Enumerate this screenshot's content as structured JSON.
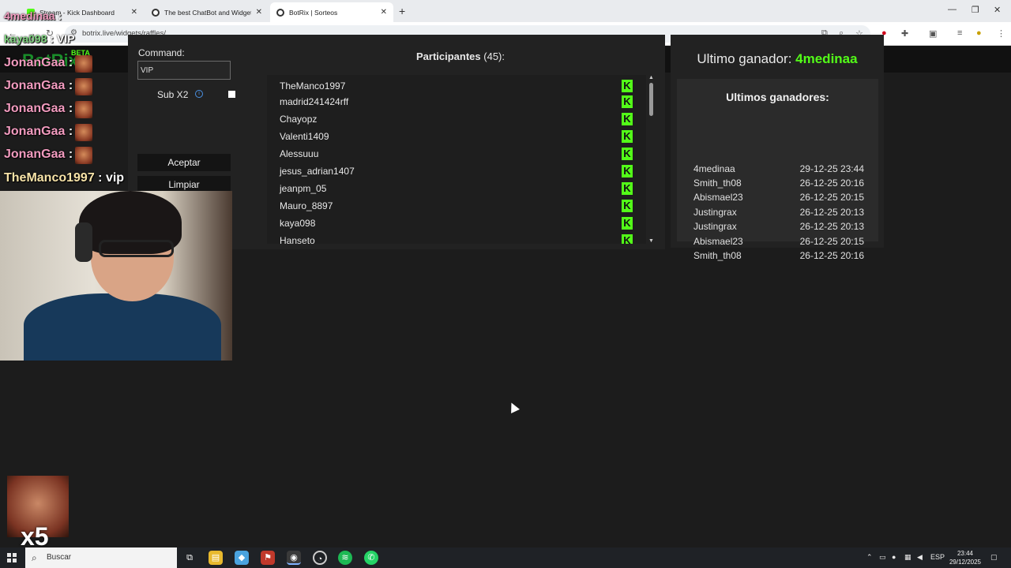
{
  "browser": {
    "tabs": [
      {
        "title": "Stream - Kick Dashboard",
        "favicon_color": "#53fc18"
      },
      {
        "title": "The best ChatBot and Widgets",
        "favicon_color": "#333333"
      },
      {
        "title": "BotRix | Sorteos",
        "favicon_color": "#333333"
      }
    ],
    "url": "botrix.live/widgets/raffles/"
  },
  "site": {
    "logo": "BotRix",
    "beta": "BETA"
  },
  "command": {
    "label": "Command:",
    "value": "VIP",
    "sub_label": "Sub X2",
    "info": "i",
    "accept": "Aceptar",
    "clear": "Limpiar"
  },
  "participants": {
    "title": "Participantes",
    "count": "(45):",
    "badge": "K",
    "items": [
      "TheManco1997",
      "madrid241424rff",
      "Chayopz",
      "Valenti1409",
      "Alessuuu",
      "jesus_adrian1407",
      "jeanpm_05",
      "Mauro_8897",
      "kaya098",
      "Hanseto"
    ]
  },
  "winners": {
    "last_label": "Ultimo ganador:",
    "last_name": "4medinaa",
    "list_title": "Ultimos ganadores:",
    "items": [
      {
        "name": "4medinaa",
        "date": "29-12-25 23:44"
      },
      {
        "name": "Smith_th08",
        "date": "26-12-25 20:16"
      },
      {
        "name": "Abismael23",
        "date": "26-12-25 20:15"
      },
      {
        "name": "Justingrax",
        "date": "26-12-25 20:13"
      },
      {
        "name": "Justingrax",
        "date": "26-12-25 20:13"
      },
      {
        "name": "Abismael23",
        "date": "26-12-25 20:15"
      },
      {
        "name": "Smith_th08",
        "date": "26-12-25 20:16"
      }
    ]
  },
  "overlay": {
    "chat": [
      {
        "user": "4medinaa",
        "sep": ":"
      },
      {
        "user": "kaya098",
        "sep": ":",
        "msg": "VIP"
      },
      {
        "user": "JonanGaa",
        "sep": ":"
      },
      {
        "user": "JonanGaa",
        "sep": ":"
      },
      {
        "user": "JonanGaa",
        "sep": ":"
      },
      {
        "user": "JonanGaa",
        "sep": ":"
      },
      {
        "user": "JonanGaa",
        "sep": ":"
      },
      {
        "user": "TheManco1997",
        "sep": ":",
        "msg": "vip"
      }
    ],
    "multiplier": "x5"
  },
  "taskbar": {
    "search": "Buscar",
    "lang": "ESP",
    "time": "23:44",
    "date": "29/12/2025"
  }
}
